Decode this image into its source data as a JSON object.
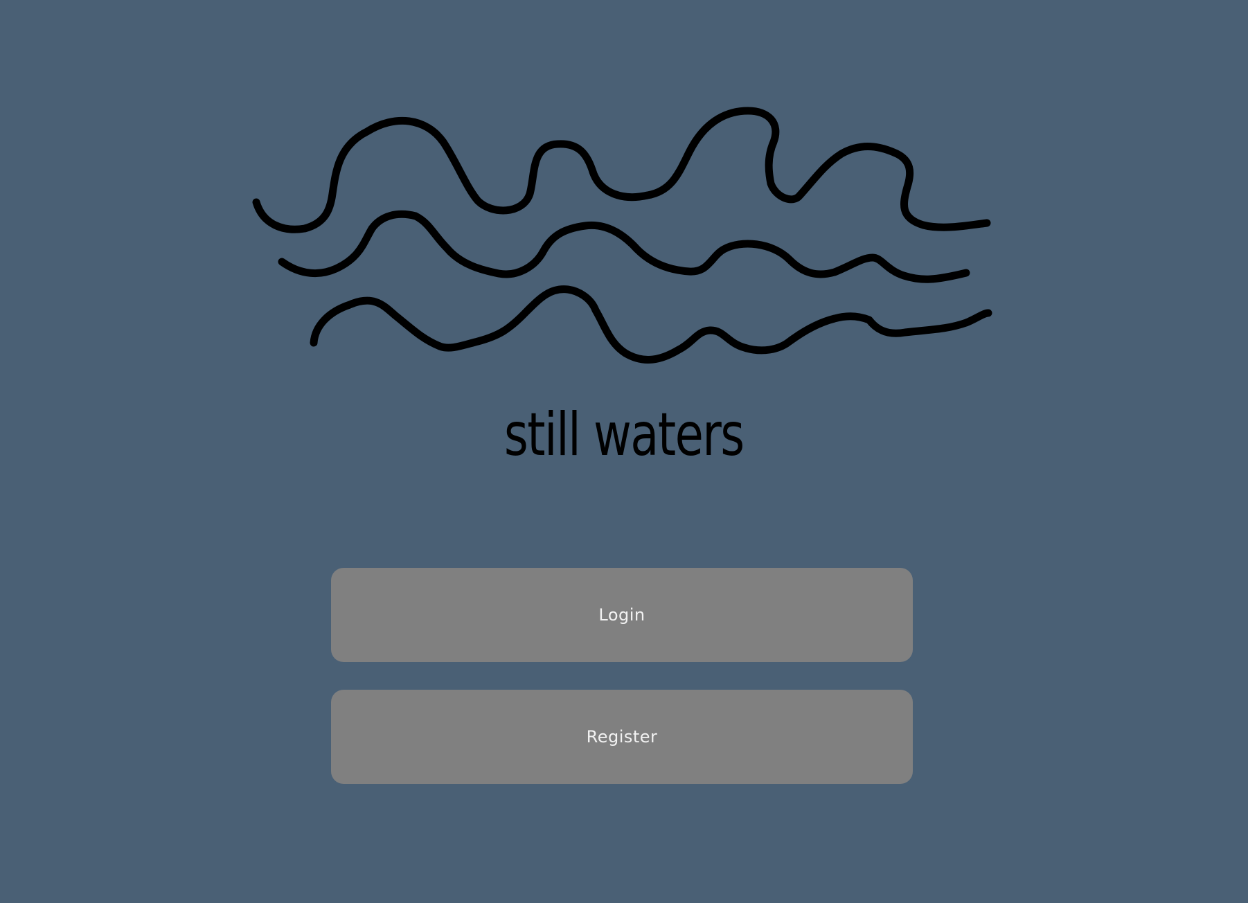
{
  "app": {
    "title": "still waters",
    "background_color": "#4a6075"
  },
  "logo": {
    "icon": "waves-icon"
  },
  "actions": {
    "login_label": "Login",
    "register_label": "Register",
    "button_color": "#808080",
    "button_text_color": "#f2f2f2"
  }
}
